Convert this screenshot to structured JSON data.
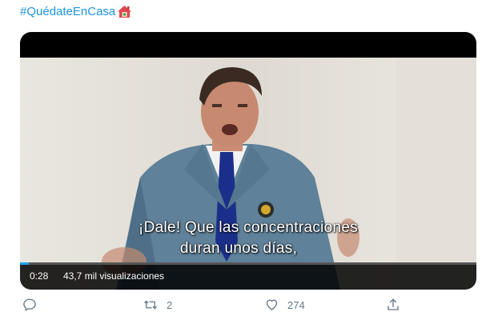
{
  "tweet": {
    "hashtag": "#QuédateEnCasa",
    "hashtag_icon": "house-emoji-icon"
  },
  "video": {
    "subtitle_line1": "¡Dale! Que las concentraciones",
    "subtitle_line2": "duran unos días,",
    "elapsed_time": "0:28",
    "views": "43,7 mil visualizaciones",
    "progress_percent": 2
  },
  "actions": {
    "reply_icon": "reply-icon",
    "retweet_icon": "retweet-icon",
    "retweet_count": "2",
    "like_icon": "heart-icon",
    "like_count": "274",
    "share_icon": "share-icon"
  },
  "colors": {
    "link": "#1b95e0",
    "action_gray": "#657786",
    "progress": "#1da1f2"
  }
}
